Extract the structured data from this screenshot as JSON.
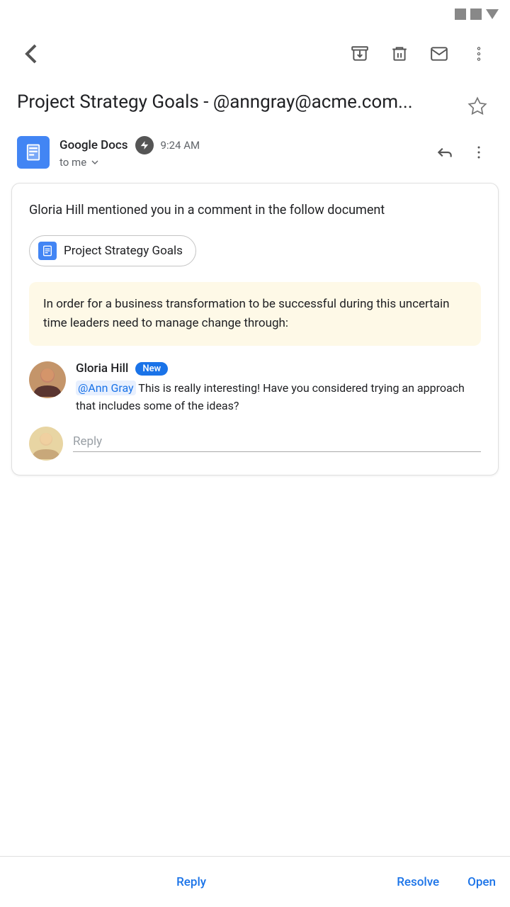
{
  "statusBar": {
    "icons": [
      "signal1",
      "signal2",
      "dropdown"
    ]
  },
  "toolbar": {
    "backLabel": "back",
    "archiveLabel": "archive",
    "deleteLabel": "delete",
    "mailLabel": "mail",
    "moreLabel": "more options"
  },
  "email": {
    "subject": "Project Strategy Goals - @anngray@acme.com...",
    "star": "☆",
    "sender": {
      "name": "Google Docs",
      "time": "9:24 AM",
      "to": "to me"
    }
  },
  "body": {
    "mentionText": "Gloria Hill mentioned you in a comment in the follow document",
    "docChip": {
      "label": "Project Strategy Goals"
    },
    "quoteText": "In order for a business transformation to be successful during this uncertain time leaders need to manage change through:",
    "comment": {
      "author": "Gloria Hill",
      "badge": "New",
      "mention": "@Ann Gray",
      "text": " This is really interesting! Have you considered trying an approach that includes some of the ideas?"
    },
    "replyPlaceholder": "Reply"
  },
  "bottomBar": {
    "replyLabel": "Reply",
    "resolveLabel": "Resolve",
    "openLabel": "Open"
  }
}
